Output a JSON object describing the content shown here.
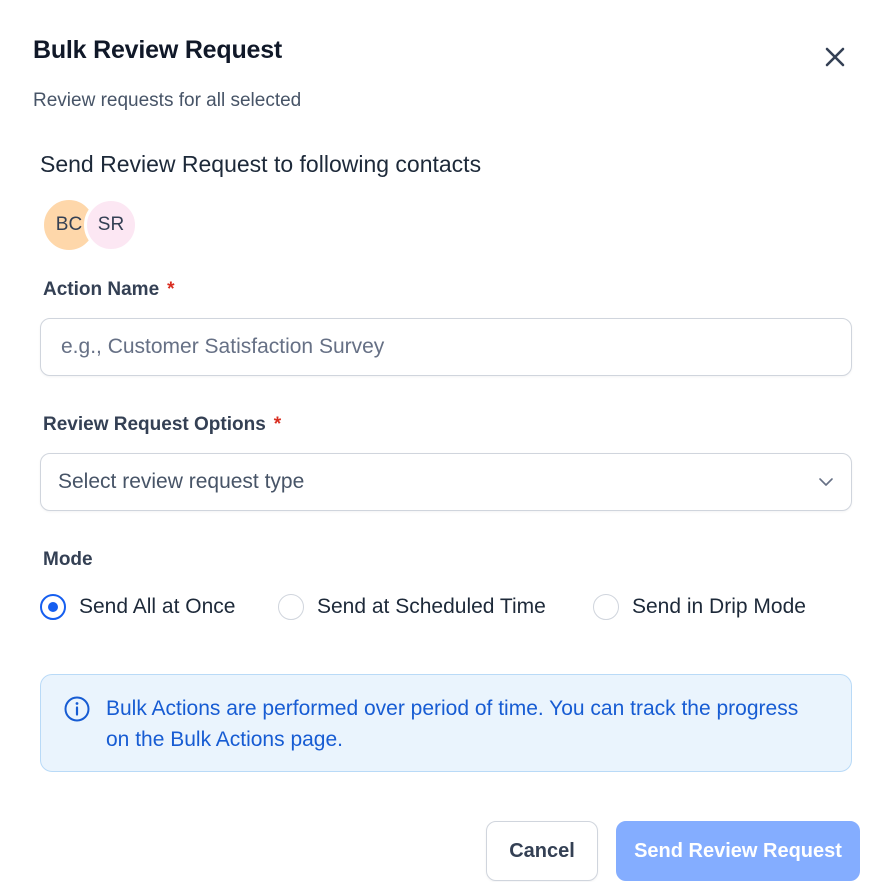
{
  "dialog": {
    "title": "Bulk Review Request",
    "subtitle": "Review requests for all selected"
  },
  "contacts": {
    "heading": "Send Review Request to following contacts",
    "avatars": [
      "BC",
      "SR"
    ]
  },
  "action_name": {
    "label": "Action Name",
    "required_mark": "*",
    "value": "",
    "placeholder": "e.g., Customer Satisfaction Survey"
  },
  "options": {
    "label": "Review Request Options",
    "required_mark": "*",
    "placeholder": "Select review request type"
  },
  "mode": {
    "label": "Mode",
    "items": [
      {
        "label": "Send All at Once",
        "checked": true
      },
      {
        "label": "Send at Scheduled Time",
        "checked": false
      },
      {
        "label": "Send in Drip Mode",
        "checked": false
      }
    ]
  },
  "info": {
    "text": "Bulk Actions are performed over period of time. You can track the progress on the Bulk Actions page."
  },
  "footer": {
    "cancel_label": "Cancel",
    "send_label": "Send Review Request"
  },
  "colors": {
    "primary": "#155eef",
    "primary_disabled": "#84adff",
    "required": "#d92d20",
    "info_bg": "#eaf4fd",
    "info_text": "#175cd3"
  },
  "icons": [
    "close-icon",
    "chevron-down-icon",
    "info-icon"
  ]
}
